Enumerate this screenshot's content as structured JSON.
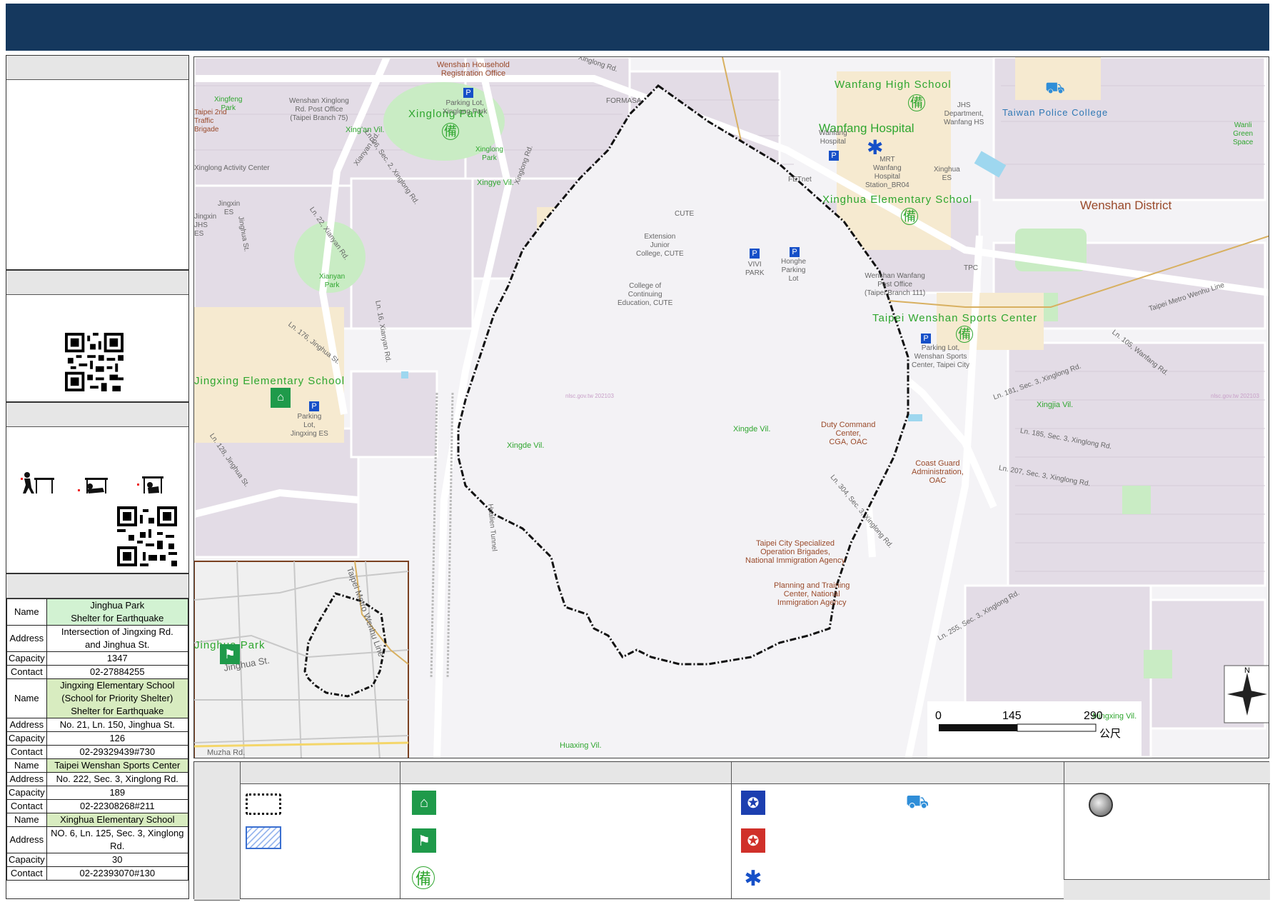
{
  "colors": {
    "header": "#15385e",
    "park": "#c9ecc4",
    "school": "#f6ead0",
    "road": "#ffffff",
    "block": "#e4dde7",
    "boundary": "#111111",
    "shelter_icon": "#1f9a4a",
    "hospital": "#1650c8"
  },
  "left_panel": {
    "table": [
      {
        "rows": [
          {
            "key": "Name",
            "value": "Jinghua Park\nShelter for Earthquake",
            "hl": "hl"
          },
          {
            "key": "Address",
            "value": "Intersection of Jingxing Rd.\nand Jinghua St."
          },
          {
            "key": "Capacity",
            "value": "1347"
          },
          {
            "key": "Contact",
            "value": "02-27884255"
          }
        ]
      },
      {
        "rows": [
          {
            "key": "Name",
            "value": "Jingxing Elementary School\n(School for Priority Shelter)\nShelter for Earthquake",
            "hl": "hl2"
          },
          {
            "key": "Address",
            "value": "No. 21, Ln. 150, Jinghua St."
          },
          {
            "key": "Capacity",
            "value": "126"
          },
          {
            "key": "Contact",
            "value": "02-29329439#730"
          }
        ]
      },
      {
        "rows": [
          {
            "key": "Name",
            "value": "Taipei Wenshan Sports Center",
            "hl": "hl2"
          },
          {
            "key": "Address",
            "value": "No. 222, Sec. 3, Xinglong Rd."
          },
          {
            "key": "Capacity",
            "value": "189"
          },
          {
            "key": "Contact",
            "value": "02-22308268#211"
          }
        ]
      },
      {
        "rows": [
          {
            "key": "Name",
            "value": "Xinghua Elementary School",
            "hl": "hl2"
          },
          {
            "key": "Address",
            "value": "NO. 6, Ln. 125, Sec. 3, Xinglong Rd."
          },
          {
            "key": "Capacity",
            "value": "30"
          },
          {
            "key": "Contact",
            "value": "02-22393070#130"
          }
        ]
      }
    ]
  },
  "map": {
    "district": "Wenshan District",
    "watermark": "nlsc.gov.tw 202103",
    "facilities": [
      {
        "id": "wanfang-hs",
        "text": "Wanfang High School"
      },
      {
        "id": "wanfang-hosp",
        "text": "Wanfang Hospital"
      },
      {
        "id": "xinghua-es",
        "text": "Xinghua Elementary School"
      },
      {
        "id": "wenshan-sports",
        "text": "Taipei Wenshan Sports Center"
      },
      {
        "id": "jingxing-es",
        "text": "Jingxing Elementary School"
      },
      {
        "id": "xinglong-park",
        "text": "Xinglong Park"
      },
      {
        "id": "police-college",
        "text": "Taiwan Police College"
      }
    ],
    "pois": [
      {
        "id": "household",
        "text": "Wenshan Household\nRegistration Office"
      },
      {
        "id": "post-75",
        "text": "Wenshan Xinglong\nRd. Post Office\n(Taipei Branch 75)"
      },
      {
        "id": "parking-xinglong",
        "text": "Parking Lot,\nXinglong Park"
      },
      {
        "id": "formasa",
        "text": "FORMASA"
      },
      {
        "id": "jhs",
        "text": "JHS\nDepartment,\nWanfang HS"
      },
      {
        "id": "wanfang-hosp-s",
        "text": "Wanfang\nHospital"
      },
      {
        "id": "mrt",
        "text": "MRT\nWanfang\nHospital\nStation_BR04"
      },
      {
        "id": "fetnet",
        "text": "FETnet"
      },
      {
        "id": "xinghua-es-s",
        "text": "Xinghua\nES"
      },
      {
        "id": "cute",
        "text": "CUTE"
      },
      {
        "id": "ext-cute",
        "text": "Extension\nJunior\nCollege, CUTE"
      },
      {
        "id": "vivi",
        "text": "VIVI\nPARK"
      },
      {
        "id": "honghe",
        "text": "Honghe\nParking\nLot"
      },
      {
        "id": "cont-cute",
        "text": "College of\nContinuing\nEducation, CUTE"
      },
      {
        "id": "post-111",
        "text": "Wenshan Wanfang\nPost Office\n(Taipei Branch 111)"
      },
      {
        "id": "tpc",
        "text": "TPC"
      },
      {
        "id": "parking-sports",
        "text": "Parking Lot,\nWenshan Sports\nCenter, Taipei City"
      },
      {
        "id": "duty",
        "text": "Duty Command\nCenter,\nCGA, OAC"
      },
      {
        "id": "coast",
        "text": "Coast Guard\nAdministration,\nOAC"
      },
      {
        "id": "special-ops",
        "text": "Taipei City Specialized\nOperation Brigades,\nNational Immigration Agency"
      },
      {
        "id": "planning",
        "text": "Planning and Training\nCenter, National\nImmigration Agency"
      },
      {
        "id": "parking-jingxing",
        "text": "Parking\nLot,\nJingxing ES"
      },
      {
        "id": "jingxin-es",
        "text": "Jingxin\nES"
      },
      {
        "id": "jingxin-jhs",
        "text": "Jingxin\nJHS\nES"
      },
      {
        "id": "xinglong-activity",
        "text": "Xinglong Activity Center"
      },
      {
        "id": "traffic",
        "text": "Taipei 2nd\nTraffic\nBrigade"
      },
      {
        "id": "xingfeng",
        "text": "Xingfeng\nPark"
      },
      {
        "id": "xianyan-park",
        "text": "Xianyan\nPark"
      },
      {
        "id": "xinglong-park-s",
        "text": "Xinglong\nPark"
      },
      {
        "id": "wanli",
        "text": "Wanli\nGreen\nSpace"
      }
    ],
    "villages": [
      {
        "id": "xingan",
        "text": "Xing'an Vil."
      },
      {
        "id": "xingye",
        "text": "Xingye Vil."
      },
      {
        "id": "xingde",
        "text": "Xingde Vil."
      },
      {
        "id": "xingde2",
        "text": "Xingde Vil."
      },
      {
        "id": "xingjia",
        "text": "Xingjia Vil."
      },
      {
        "id": "mingxing",
        "text": "Mingxing Vil."
      },
      {
        "id": "huaxing",
        "text": "Huaxing Vil."
      }
    ],
    "roads": [
      {
        "id": "r1",
        "text": "Ln. 96, Sec. 2, Xinglong Rd."
      },
      {
        "id": "r2",
        "text": "Xianyan Rd."
      },
      {
        "id": "r3",
        "text": "Ln. 22, Xianyan Rd."
      },
      {
        "id": "r4",
        "text": "Jinghua St."
      },
      {
        "id": "r5",
        "text": "Ln. 176, Jinghua St."
      },
      {
        "id": "r6",
        "text": "Ln. 16, Xianyan Rd."
      },
      {
        "id": "r7",
        "text": "Ln. 128, Jinghua St."
      },
      {
        "id": "r8",
        "text": "Ln. 181, Sec. 3, Xinglong Rd."
      },
      {
        "id": "r9",
        "text": "Ln. 185, Sec. 3, Xinglong Rd."
      },
      {
        "id": "r10",
        "text": "Ln. 207, Sec. 3, Xinglong Rd."
      },
      {
        "id": "r11",
        "text": "Ln. 304, Sec. 3, Xinglong Rd."
      },
      {
        "id": "r12",
        "text": "Ln. 255, Sec. 3, Xinglong Rd."
      },
      {
        "id": "r13",
        "text": "Ln. 105, Wanfang Rd."
      },
      {
        "id": "r14",
        "text": "Taipei Metro Wenhu Line"
      },
      {
        "id": "r15",
        "text": "Hualien Tunnel"
      },
      {
        "id": "r16",
        "text": "Xinglong Rd."
      },
      {
        "id": "r17",
        "text": "Muzha Rd."
      },
      {
        "id": "r18",
        "text": "Xinglong Rd."
      }
    ],
    "inset": {
      "label": "Jinghua Park",
      "street": "Jinghua St.",
      "road": "Taipei Metro Wenhu Line",
      "corner": "Muzha"
    },
    "scale": {
      "ticks": [
        "0",
        "145",
        "290"
      ],
      "unit": "公尺"
    },
    "north": "N"
  }
}
